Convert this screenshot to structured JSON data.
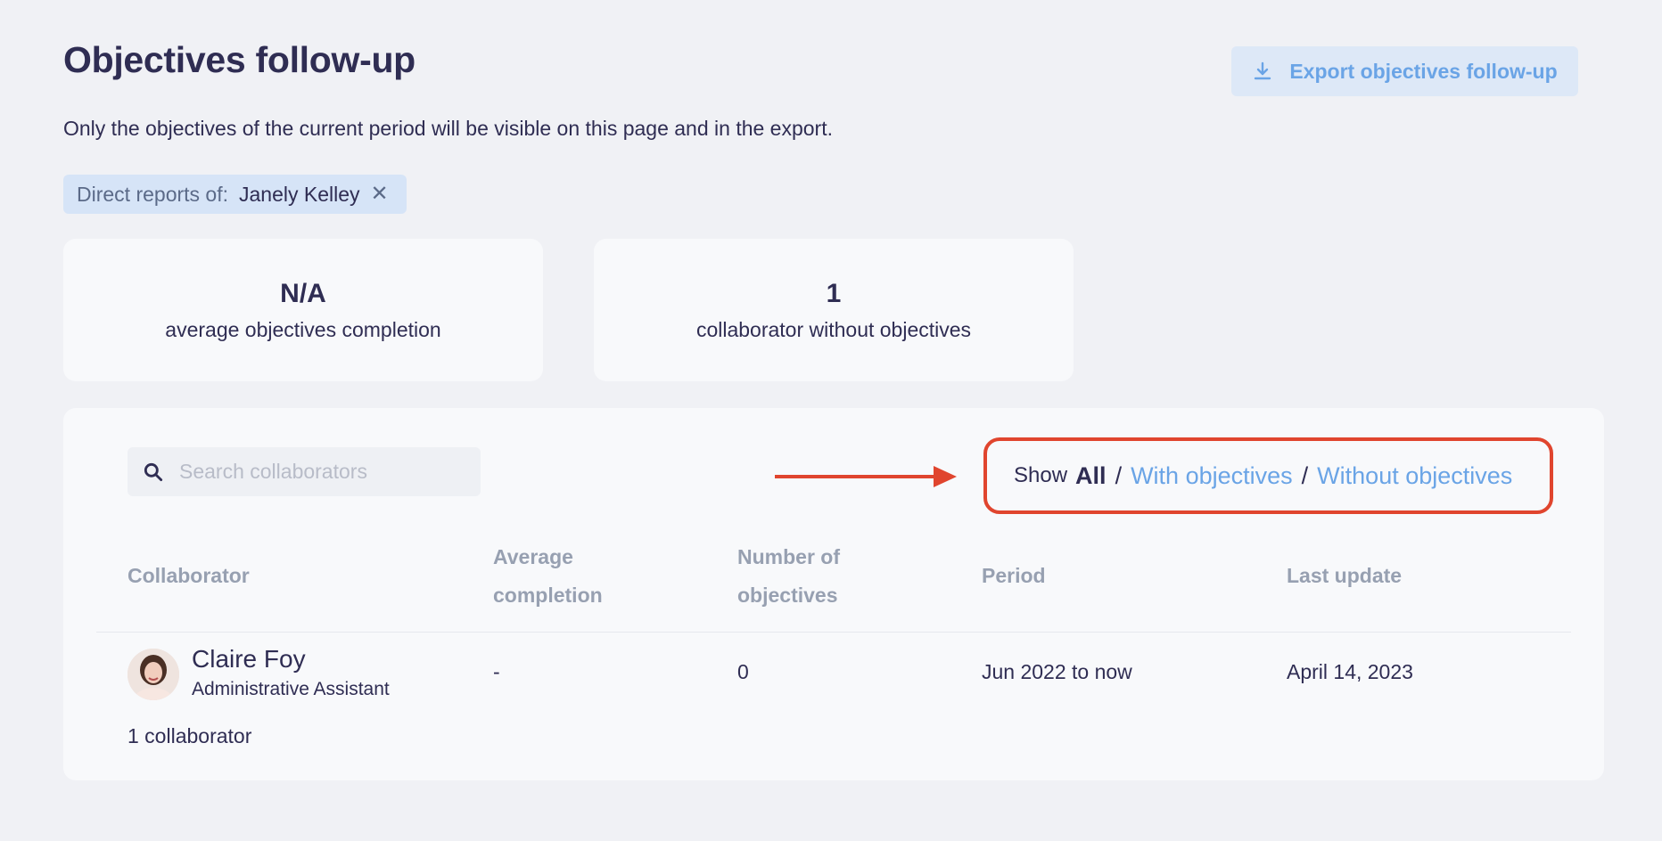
{
  "header": {
    "title": "Objectives follow-up",
    "export_label": "Export objectives follow-up",
    "export_icon": "download-icon",
    "subtitle": "Only the objectives of the current period will be visible on this page and in the export."
  },
  "filter": {
    "prefix": "Direct reports of:",
    "value": "Janely Kelley",
    "remove_icon": "close-icon"
  },
  "stats": [
    {
      "value": "N/A",
      "label": "average objectives completion"
    },
    {
      "value": "1",
      "label": "collaborator without objectives"
    }
  ],
  "panel": {
    "search": {
      "placeholder": "Search collaborators",
      "value": ""
    },
    "show": {
      "label": "Show",
      "all": "All",
      "separator": "/",
      "with": "With objectives",
      "without": "Without objectives"
    },
    "columns": {
      "collaborator": "Collaborator",
      "avg_line1": "Average",
      "avg_line2": "completion",
      "num_line1": "Number of",
      "num_line2": "objectives",
      "period": "Period",
      "last_update": "Last update"
    },
    "rows": [
      {
        "name": "Claire Foy",
        "role": "Administrative Assistant",
        "average_completion": "-",
        "number_of_objectives": "0",
        "period": "Jun 2022 to now",
        "last_update": "April 14, 2023"
      }
    ],
    "footer": "1 collaborator"
  },
  "colors": {
    "title": "#2f2d53",
    "link": "#6aa4e6",
    "highlight": "#e0452e",
    "background": "#f0f1f5"
  }
}
